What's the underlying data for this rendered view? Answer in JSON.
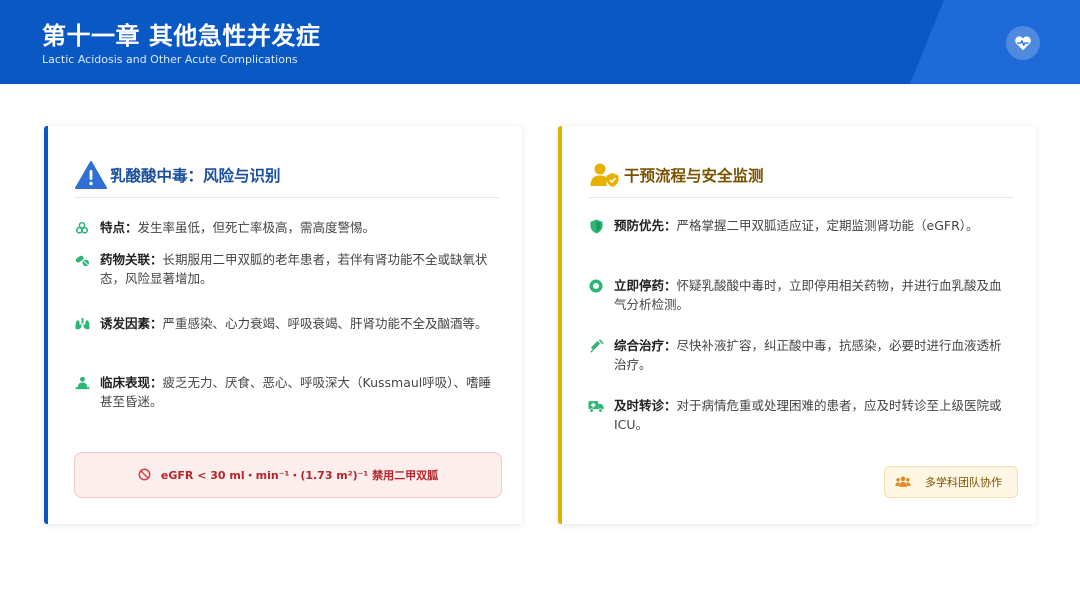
{
  "header": {
    "title": "第十一章 其他急性并发症",
    "subtitle": "Lactic Acidosis and Other Acute Complications",
    "badge_icon": "heart-pulse-icon"
  },
  "left_card": {
    "title": "乳酸酸中毒：风险与识别",
    "title_icon": "warning-triangle-icon",
    "accent": "#0a58c4",
    "items": [
      {
        "icon": "biohazard-icon",
        "label": "特点：",
        "text": "发生率虽低，但死亡率极高，需高度警惕。"
      },
      {
        "icon": "pills-icon",
        "label": "药物关联：",
        "text": "长期服用二甲双胍的老年患者，若伴有肾功能不全或缺氧状态，风险显著增加。"
      },
      {
        "icon": "lungs-icon",
        "label": "诱发因素：",
        "text": "严重感染、心力衰竭、呼吸衰竭、肝肾功能不全及酗酒等。"
      },
      {
        "icon": "patient-icon",
        "label": "临床表现：",
        "text": "疲乏无力、厌食、恶心、呼吸深大（Kussmaul呼吸）、嗜睡甚至昏迷。"
      }
    ],
    "warning": {
      "icon": "ban-icon",
      "text": "eGFR < 30 ml・min⁻¹・(1.73 m²)⁻¹ 禁用二甲双胍"
    }
  },
  "right_card": {
    "title": "干预流程与安全监测",
    "title_icon": "user-shield-icon",
    "accent": "#e0b000",
    "items": [
      {
        "icon": "shield-icon",
        "label": "预防优先：",
        "text": "严格掌握二甲双胍适应证，定期监测肾功能（eGFR）。"
      },
      {
        "icon": "stop-circle-icon",
        "label": "立即停药：",
        "text": "怀疑乳酸酸中毒时，立即停用相关药物，并进行血乳酸及血气分析检测。"
      },
      {
        "icon": "syringe-icon",
        "label": "综合治疗：",
        "text": "尽快补液扩容，纠正酸中毒，抗感染，必要时进行血液透析治疗。"
      },
      {
        "icon": "ambulance-icon",
        "label": "及时转诊：",
        "text": "对于病情危重或处理困难的患者，应及时转诊至上级医院或ICU。"
      }
    ],
    "team": {
      "icon": "team-icon",
      "text": "多学科团队协作"
    }
  }
}
